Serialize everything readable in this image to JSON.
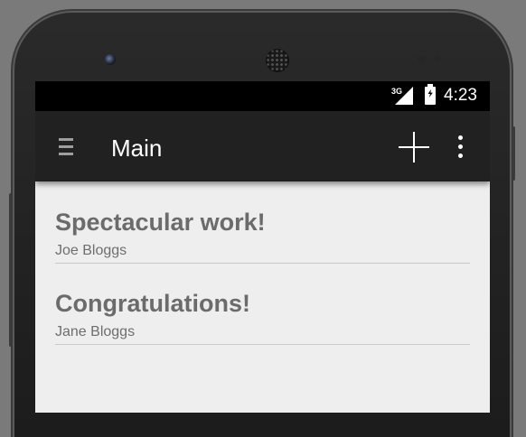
{
  "status_bar": {
    "network": "3G",
    "signal_icon": "cellular-signal-icon",
    "battery_icon": "battery-charging-icon",
    "time": "4:23"
  },
  "app_bar": {
    "menu_icon": "hamburger-menu-icon",
    "title": "Main",
    "add_icon": "add-icon",
    "overflow_icon": "overflow-menu-icon",
    "background": "#212121"
  },
  "list": {
    "items": [
      {
        "title": "Spectacular work!",
        "subtitle": "Joe Bloggs"
      },
      {
        "title": "Congratulations!",
        "subtitle": "Jane Bloggs"
      }
    ]
  },
  "colors": {
    "screen_background": "#eeeeee",
    "text_primary": "#6b6b6b",
    "divider": "#c9c9c9"
  }
}
